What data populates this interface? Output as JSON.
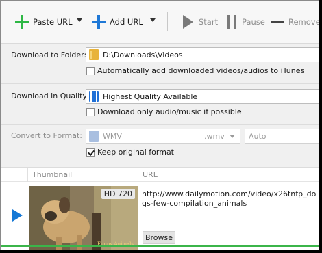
{
  "toolbar": {
    "paste_url": "Paste URL",
    "add_url": "Add URL",
    "start": "Start",
    "pause": "Pause",
    "remove": "Remove",
    "icons": {
      "paste": "green-plus-icon",
      "add": "blue-plus-icon",
      "start": "play-icon",
      "pause": "pause-icon",
      "remove": "minus-icon"
    },
    "colors": {
      "paste_plus": "#2db744",
      "add_plus": "#1f78d6"
    }
  },
  "download_folder": {
    "label": "Download to Folder:",
    "value": "D:\\Downloads\\Videos",
    "itunes_checkbox": {
      "label": "Automatically add downloaded videos/audios to iTunes",
      "checked": false
    }
  },
  "quality": {
    "label": "Download in Quality:",
    "value": "Highest Quality Available",
    "audio_only_checkbox": {
      "label": "Download only audio/music if possible",
      "checked": false
    }
  },
  "convert": {
    "label": "Convert to Format:",
    "format": "WMV",
    "extension": ".wmv",
    "option": "Auto",
    "keep_original_checkbox": {
      "label": "Keep original format",
      "checked": true
    }
  },
  "table": {
    "columns": [
      "Thumbnail",
      "URL"
    ],
    "rows": [
      {
        "badge": "HD 720",
        "thumb_caption": "Funny Animals",
        "url": "http://www.dailymotion.com/video/x26tnfp_dogs-few-compilation_animals",
        "browse": "Browse"
      }
    ]
  },
  "accent_colors": {
    "play": "#1679d6",
    "progress": "#3bb54a"
  }
}
